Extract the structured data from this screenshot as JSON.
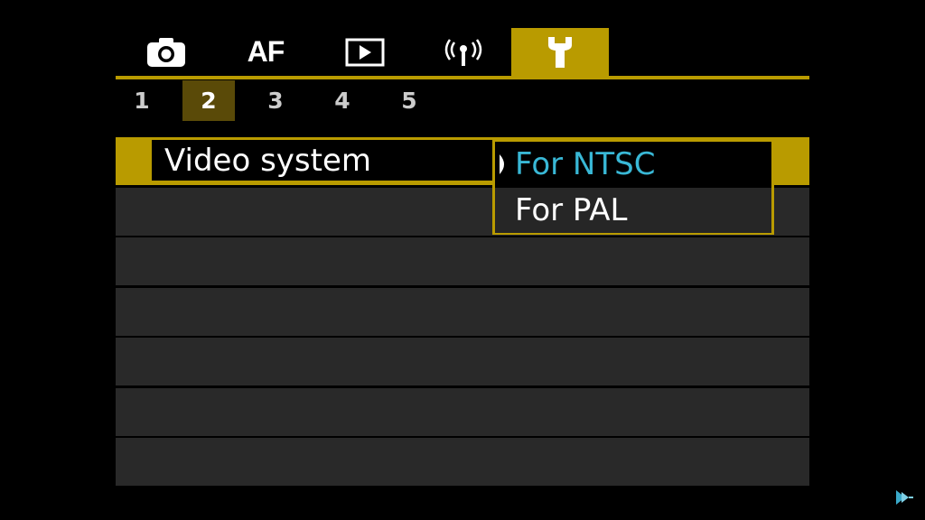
{
  "tabs": [
    {
      "icon": "camera-icon",
      "label": ""
    },
    {
      "icon": "af-icon",
      "label": "AF"
    },
    {
      "icon": "playback-icon",
      "label": ""
    },
    {
      "icon": "wireless-icon",
      "label": ""
    },
    {
      "icon": "wrench-icon",
      "label": ""
    }
  ],
  "active_tab": 4,
  "pages": [
    "1",
    "2",
    "3",
    "4",
    "5"
  ],
  "active_page": 1,
  "menu": {
    "items": [
      "Video system"
    ],
    "selected_index": 0
  },
  "dropdown": {
    "options": [
      "For NTSC",
      "For PAL"
    ],
    "selected_index": 0
  },
  "colors": {
    "accent": "#b99b00",
    "highlight_text": "#39b8d6",
    "row_bg": "#292929",
    "background": "#000000"
  }
}
